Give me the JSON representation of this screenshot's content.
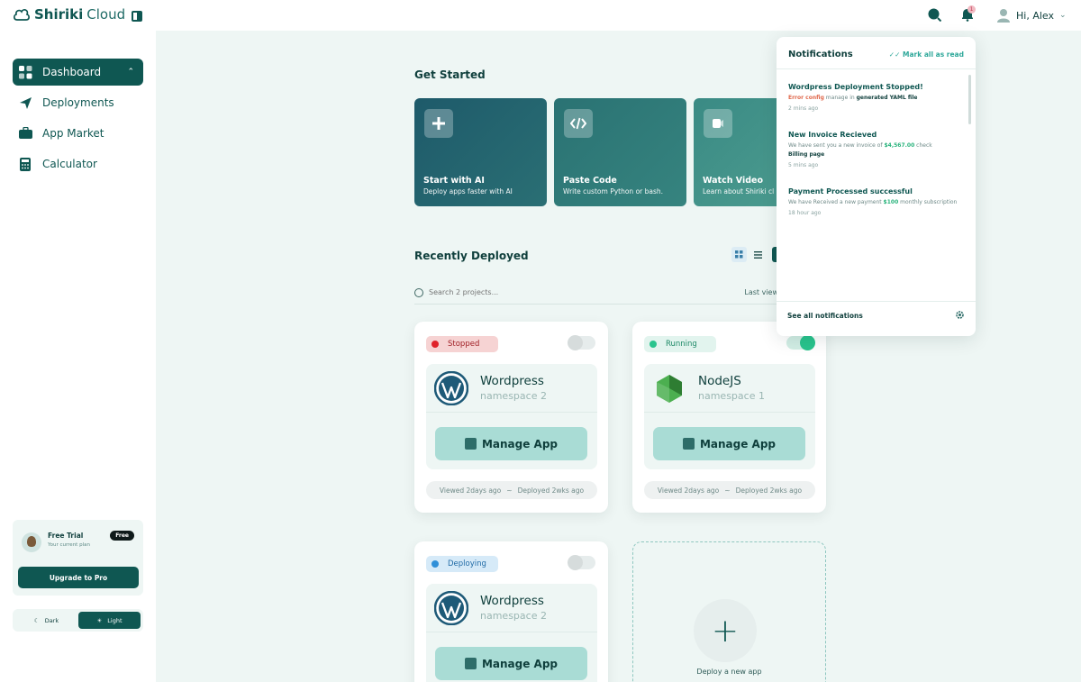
{
  "app": {
    "brand_bold": "Shiriki",
    "brand_light": "Cloud"
  },
  "sidebar": {
    "items": [
      {
        "label": "Dashboard",
        "icon": "grid-icon",
        "active": true
      },
      {
        "label": "Deployments",
        "icon": "paper-plane-icon"
      },
      {
        "label": "App Market",
        "icon": "briefcase-icon"
      },
      {
        "label": "Calculator",
        "icon": "calculator-icon"
      }
    ],
    "plan": {
      "title": "Free Trial",
      "subtitle": "Your current plan",
      "badge": "Free",
      "upgrade_label": "Upgrade to Pro"
    },
    "theme": {
      "dark_label": "Dark",
      "light_label": "Light",
      "selected": "light"
    }
  },
  "header": {
    "greeting": "Hi, Alex",
    "notification_count": "1"
  },
  "get_started": {
    "title": "Get Started",
    "cards": [
      {
        "title": "Start with AI",
        "desc": "Deploy apps faster with AI",
        "icon": "sparkle-plus-icon"
      },
      {
        "title": "Paste Code",
        "desc": "Write custom Python or bash.",
        "icon": "code-icon"
      },
      {
        "title": "Watch Video",
        "desc": "Learn about Shiriki cl",
        "icon": "video-icon"
      }
    ]
  },
  "recent": {
    "title": "Recently Deployed",
    "search_placeholder": "Search 2 projects...",
    "sort_label": "Last view",
    "apps": [
      {
        "status": "Stopped",
        "name": "Wordpress",
        "namespace": "namespace 2",
        "manage": "Manage App",
        "viewed": "Viewed 2days ago",
        "sep": "~",
        "deployed": "Deployed  2wks ago",
        "enabled": false
      },
      {
        "status": "Running",
        "name": "NodeJS",
        "namespace": "namespace 1",
        "manage": "Manage App",
        "viewed": "Viewed 2days ago",
        "sep": "~",
        "deployed": "Deployed  2wks ago",
        "enabled": true
      },
      {
        "status": "Deploying",
        "name": "Wordpress",
        "namespace": "namespace 2",
        "manage": "Manage App",
        "enabled": false
      }
    ],
    "new_app_label": "Deploy a new app"
  },
  "notifications": {
    "title": "Notifications",
    "mark_all": "Mark all as read",
    "items": [
      {
        "title": "Wordpress Deployment Stopped!",
        "body_err": "Error config",
        "body_mid": " manage in  ",
        "body_bold": "generated YAML file",
        "time": "2 mins ago"
      },
      {
        "title": "New Invoice Recieved",
        "body_pre": "We have sent you a new invoice of ",
        "body_amount": "$4,567.00",
        "body_post": " check",
        "body_bold": "Billing page",
        "time": "5 mins ago"
      },
      {
        "title": "Payment Processed successful",
        "body_pre": "We have Received a new payment ",
        "body_amount": "$100",
        "body_post": " monthly subscription",
        "time": "18 hour ago"
      }
    ],
    "see_all": "See all notifications"
  },
  "colors": {
    "primary": "#0f5752",
    "accent": "#2fa89a",
    "stopped": "#e0222a",
    "running": "#29c48d",
    "deploying": "#2f8fd8"
  }
}
